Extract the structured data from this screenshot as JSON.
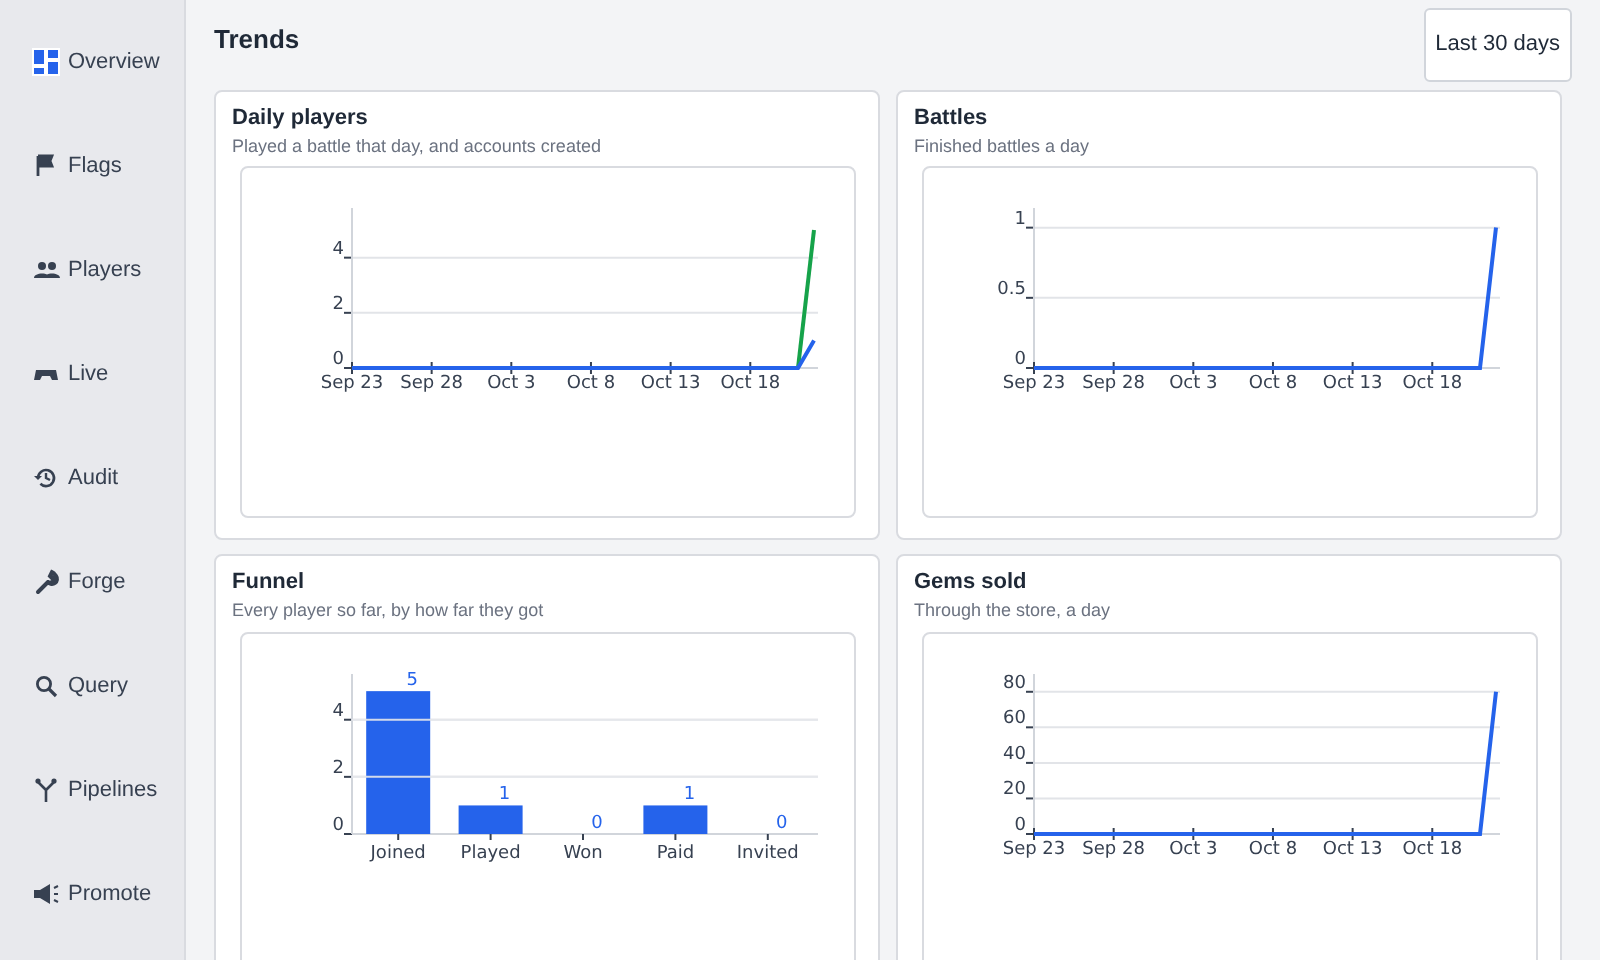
{
  "sidebar": {
    "items": [
      {
        "label": "Overview",
        "selected": true
      },
      {
        "label": "Flags",
        "selected": false
      },
      {
        "label": "Players",
        "selected": false
      },
      {
        "label": "Live",
        "selected": false
      },
      {
        "label": "Audit",
        "selected": false
      },
      {
        "label": "Forge",
        "selected": false
      },
      {
        "label": "Query",
        "selected": false
      },
      {
        "label": "Pipelines",
        "selected": false
      },
      {
        "label": "Promote",
        "selected": false
      }
    ]
  },
  "header": {
    "title": "Trends",
    "range_button": "Last 30 days"
  },
  "cards": [
    {
      "title": "Daily players",
      "subtitle": "Played a battle that day, and accounts created",
      "chart_data": {
        "type": "line",
        "grid": true,
        "ylim": [
          0,
          5.8
        ],
        "yticks": [
          0,
          2,
          4
        ],
        "categories": [
          "Sep 23",
          null,
          null,
          null,
          null,
          "Sep 28",
          null,
          null,
          null,
          null,
          "Oct 3",
          null,
          null,
          null,
          null,
          "Oct 8",
          null,
          null,
          null,
          null,
          "Oct 13",
          null,
          null,
          null,
          null,
          "Oct 18",
          null,
          null,
          null,
          null
        ],
        "series": [
          {
            "color": "#16a34a",
            "values": [
              null,
              null,
              null,
              null,
              null,
              null,
              null,
              null,
              null,
              null,
              null,
              null,
              null,
              null,
              null,
              null,
              null,
              null,
              null,
              null,
              null,
              null,
              null,
              null,
              null,
              null,
              null,
              null,
              0,
              5
            ]
          },
          {
            "color": "#2563eb",
            "values": [
              0,
              0,
              0,
              0,
              0,
              0,
              0,
              0,
              0,
              0,
              0,
              0,
              0,
              0,
              0,
              0,
              0,
              0,
              0,
              0,
              0,
              0,
              0,
              0,
              0,
              0,
              0,
              0,
              0,
              1
            ]
          }
        ]
      }
    },
    {
      "title": "Battles",
      "subtitle": "Finished battles a day",
      "chart_data": {
        "type": "line",
        "grid": true,
        "ylim": [
          0,
          1.14
        ],
        "yticks": [
          0,
          {
            "value": 0.5,
            "label": "0.5"
          },
          1
        ],
        "categories": [
          "Sep 23",
          null,
          null,
          null,
          null,
          "Sep 28",
          null,
          null,
          null,
          null,
          "Oct 3",
          null,
          null,
          null,
          null,
          "Oct 8",
          null,
          null,
          null,
          null,
          "Oct 13",
          null,
          null,
          null,
          null,
          "Oct 18",
          null,
          null,
          null,
          null
        ],
        "series": [
          {
            "color": "#2563eb",
            "values": [
              0,
              0,
              0,
              0,
              0,
              0,
              0,
              0,
              0,
              0,
              0,
              0,
              0,
              0,
              0,
              0,
              0,
              0,
              0,
              0,
              0,
              0,
              0,
              0,
              0,
              0,
              0,
              0,
              0,
              1
            ]
          }
        ]
      }
    },
    {
      "title": "Funnel",
      "subtitle": "Every player so far, by how far they got",
      "chart_data": {
        "type": "bar",
        "grid": true,
        "categories": [
          "Joined",
          "Played",
          "Won",
          "Paid",
          "Invited"
        ],
        "ylim": [
          0,
          5.6
        ],
        "yticks": [
          0,
          2,
          4
        ],
        "data_labels": true,
        "series": [
          {
            "color": "#2563eb",
            "values": [
              5,
              1,
              0,
              1,
              0
            ]
          }
        ]
      }
    },
    {
      "title": "Gems sold",
      "subtitle": "Through the store, a day",
      "chart_data": {
        "type": "line",
        "grid": true,
        "ylim": [
          0,
          90
        ],
        "yticks": [
          0,
          20,
          40,
          60,
          80
        ],
        "categories": [
          "Sep 23",
          null,
          null,
          null,
          null,
          "Sep 28",
          null,
          null,
          null,
          null,
          "Oct 3",
          null,
          null,
          null,
          null,
          "Oct 8",
          null,
          null,
          null,
          null,
          "Oct 13",
          null,
          null,
          null,
          null,
          "Oct 18",
          null,
          null,
          null,
          null
        ],
        "series": [
          {
            "color": "#2563eb",
            "values": [
              0,
              0,
              0,
              0,
              0,
              0,
              0,
              0,
              0,
              0,
              0,
              0,
              0,
              0,
              0,
              0,
              0,
              0,
              0,
              0,
              0,
              0,
              0,
              0,
              0,
              0,
              0,
              0,
              0,
              80
            ]
          }
        ]
      }
    }
  ]
}
